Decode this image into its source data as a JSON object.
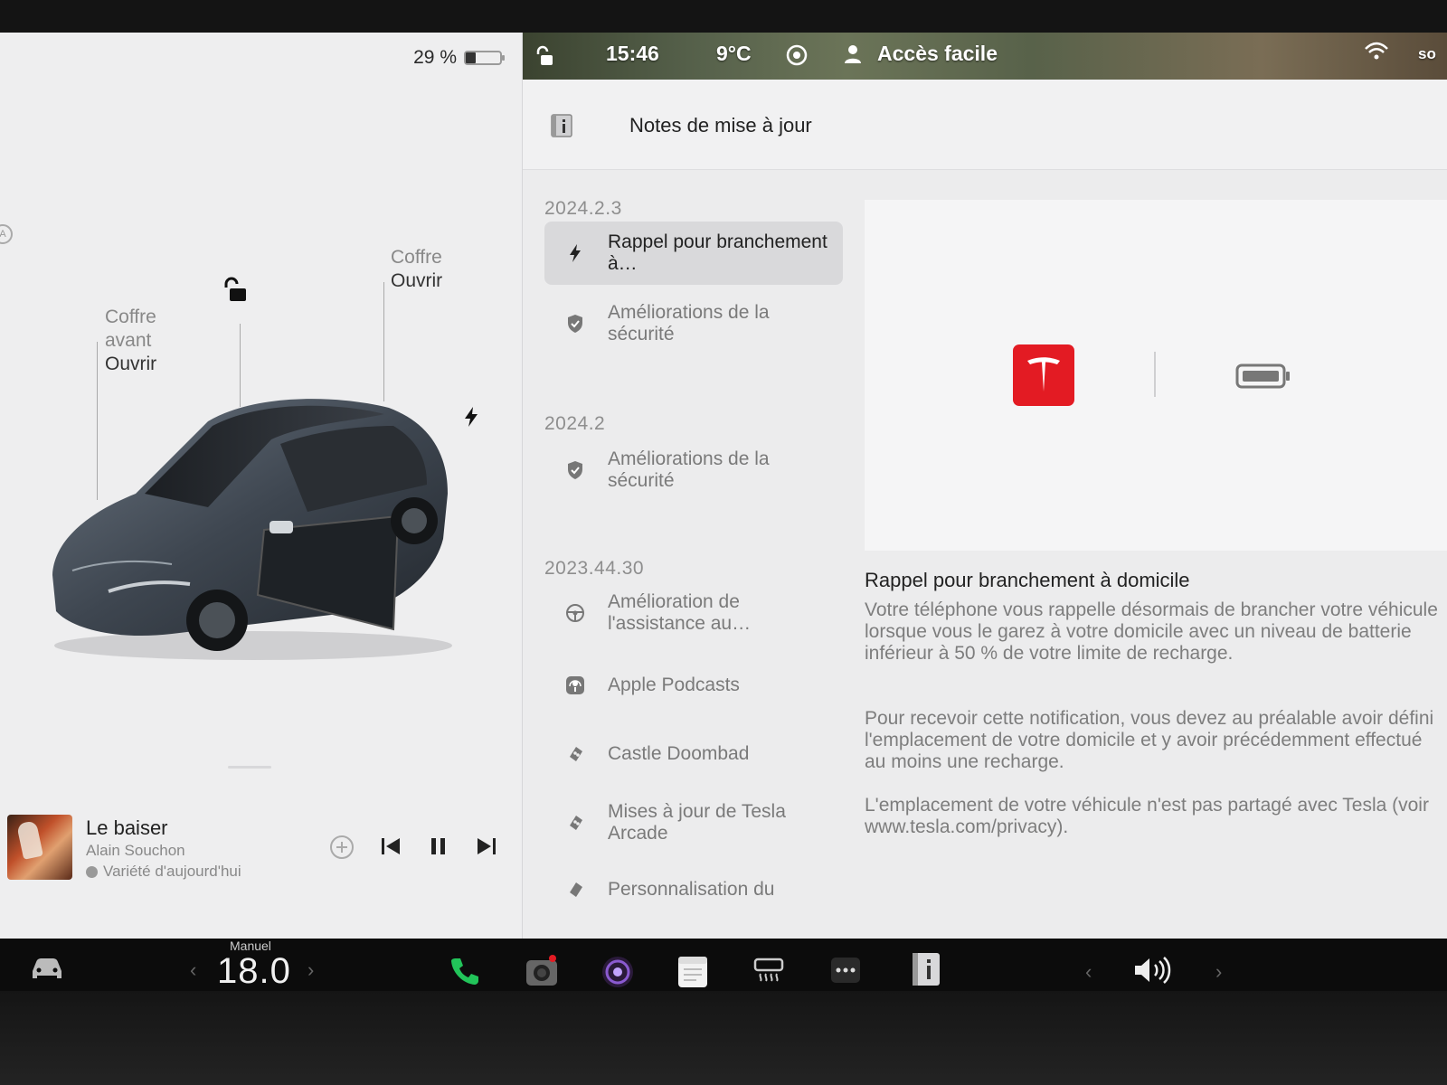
{
  "status": {
    "battery_percent": "29 %",
    "battery_level": 0.29,
    "time": "15:46",
    "temperature": "9°C",
    "profile": "Accès facile",
    "edge_badge": "A",
    "edge_text": "so"
  },
  "car": {
    "frunk": {
      "name": "Coffre",
      "name2": "avant",
      "action": "Ouvrir"
    },
    "trunk": {
      "name": "Coffre",
      "action": "Ouvrir"
    }
  },
  "media": {
    "title": "Le baiser",
    "artist": "Alain Souchon",
    "source": "Variété d'aujourd'hui"
  },
  "notes": {
    "header_title": "Notes de mise à jour",
    "groups": [
      {
        "version": "2024.2.3",
        "items": [
          {
            "label": "Rappel pour branchement à…",
            "icon": "bolt-icon",
            "selected": true
          },
          {
            "label": "Améliorations de la sécurité",
            "icon": "shield-icon"
          }
        ]
      },
      {
        "version": "2024.2",
        "items": [
          {
            "label": "Améliorations de la sécurité",
            "icon": "shield-icon"
          }
        ]
      },
      {
        "version": "2023.44.30",
        "items": [
          {
            "label": "Amélioration de l'assistance au…",
            "icon": "steering-wheel-icon"
          },
          {
            "label": "Apple Podcasts",
            "icon": "podcasts-icon"
          },
          {
            "label": "Castle Doombad",
            "icon": "game-icon"
          },
          {
            "label": "Mises à jour de Tesla Arcade",
            "icon": "game-icon"
          },
          {
            "label": "Personnalisation du",
            "icon": "game-icon"
          }
        ]
      }
    ]
  },
  "detail": {
    "title": "Rappel pour branchement à domicile",
    "paragraphs": [
      "Votre téléphone vous rappelle désormais de brancher votre véhicule lorsque vous le garez à votre domicile avec un niveau de batterie inférieur à 50 % de votre limite de recharge.",
      "Pour recevoir cette notification, vous devez au préalable avoir défini l'emplacement de votre domicile et y avoir précédemment effectué au moins une recharge.",
      "L'emplacement de votre véhicule n'est pas partagé avec Tesla (voir www.tesla.com/privacy)."
    ]
  },
  "taskbar": {
    "climate_mode": "Manuel",
    "temperature": "18.0",
    "apps": [
      "car-icon",
      "phone-icon",
      "camera-icon",
      "lens-icon",
      "calendar-icon",
      "defrost-icon",
      "more-icon",
      "release-notes-icon"
    ],
    "volume_icon": "volume-icon"
  },
  "colors": {
    "tesla_red": "#e31b23",
    "phone_green": "#22c45a",
    "selected_row": "#d9d9db"
  }
}
